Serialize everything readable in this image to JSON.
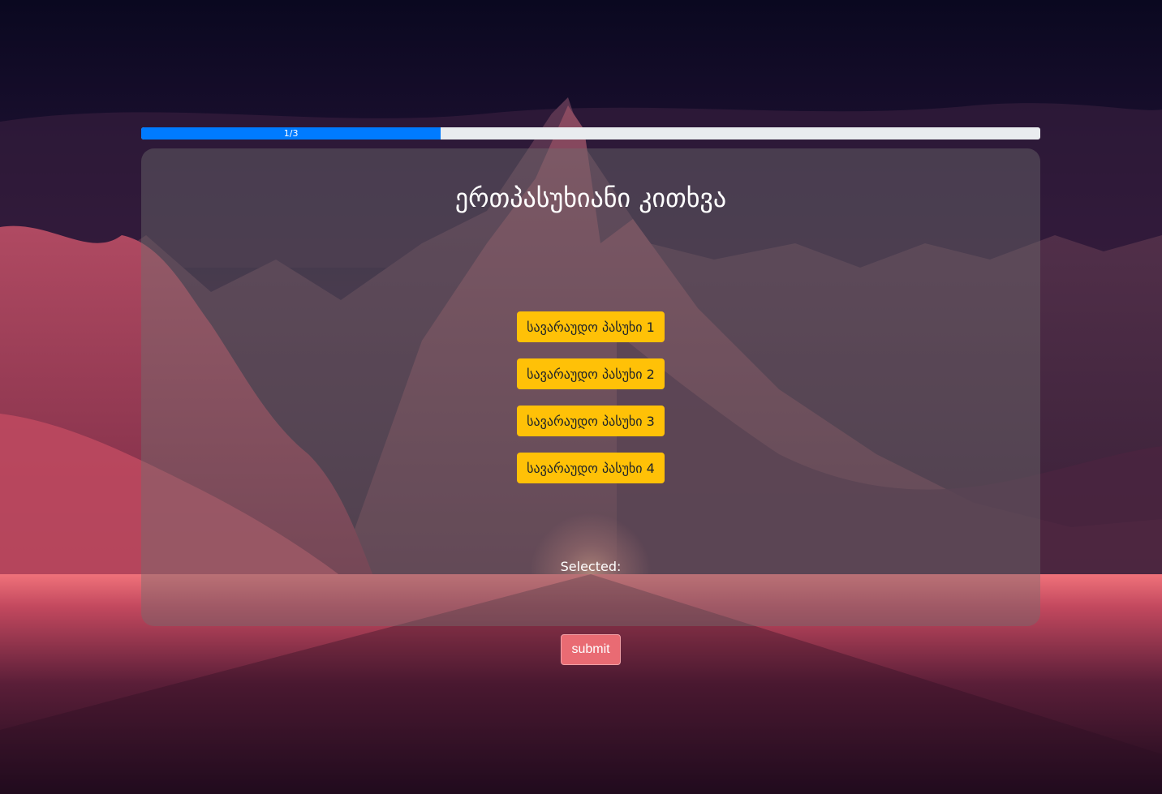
{
  "progress": {
    "label": "1/3",
    "fraction": 0.3333
  },
  "question": {
    "title": "ერთპასუხიანი კითხვა"
  },
  "answers": [
    {
      "label": "სავარაუდო პასუხი 1"
    },
    {
      "label": "სავარაუდო პასუხი 2"
    },
    {
      "label": "სავარაუდო პასუხი 3"
    },
    {
      "label": "სავარაუდო პასუხი 4"
    }
  ],
  "selection": {
    "label": "Selected:"
  },
  "actions": {
    "submit_label": "submit"
  },
  "colors": {
    "progress_fill": "#007bff",
    "answer_button": "#ffc107",
    "submit_button": "#e96b73",
    "card_background": "rgba(112,112,112,0.42)"
  }
}
